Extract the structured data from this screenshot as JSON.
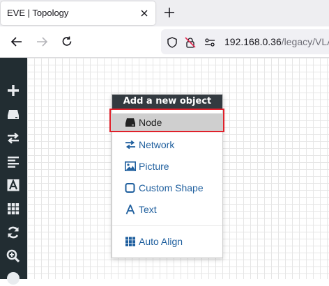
{
  "browser": {
    "tab_title": "EVE | Topology",
    "url_host": "192.168.0.36",
    "url_path": "/legacy/VLA"
  },
  "sidebar": {
    "items": [
      {
        "icon": "plus-icon"
      },
      {
        "icon": "node-icon"
      },
      {
        "icon": "network-icon"
      },
      {
        "icon": "align-left-icon"
      },
      {
        "icon": "text-icon"
      },
      {
        "icon": "grid-icon"
      },
      {
        "icon": "refresh-icon"
      },
      {
        "icon": "zoom-icon"
      },
      {
        "icon": "info-icon"
      }
    ]
  },
  "context_menu": {
    "header": "Add a new object",
    "items": [
      {
        "label": "Node",
        "icon": "node-icon",
        "active": true
      },
      {
        "label": "Network",
        "icon": "network-icon"
      },
      {
        "label": "Picture",
        "icon": "picture-icon"
      },
      {
        "label": "Custom Shape",
        "icon": "shape-icon"
      },
      {
        "label": "Text",
        "icon": "text-icon"
      },
      {
        "label": "Auto Align",
        "icon": "grid-icon"
      }
    ]
  },
  "colors": {
    "sidebar_bg": "#222d32",
    "menu_header_bg": "#333a40",
    "menu_link": "#1f5f9e",
    "highlight": "#e0202a"
  }
}
